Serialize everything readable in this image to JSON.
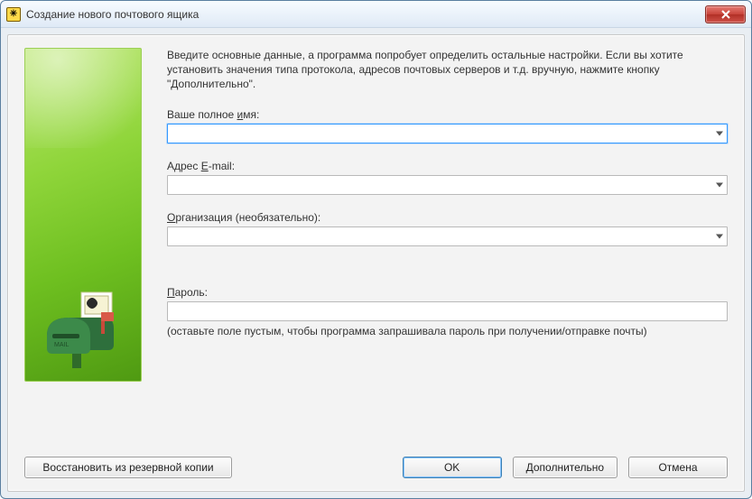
{
  "window": {
    "title": "Создание нового почтового ящика"
  },
  "intro": "Введите основные данные, а программа попробует определить остальные настройки. Если вы хотите установить значения типа протокола, адресов почтовых серверов и т.д. вручную, нажмите кнопку \"Дополнительно\".",
  "fields": {
    "name": {
      "label_pre": "Ваше полное ",
      "label_u": "и",
      "label_post": "мя:",
      "value": ""
    },
    "email": {
      "label_pre": "Адрес ",
      "label_u": "E",
      "label_post": "-mail:",
      "value": ""
    },
    "org": {
      "label_pre": "",
      "label_u": "О",
      "label_post": "рганизация (необязательно):",
      "value": ""
    },
    "password": {
      "label_pre": "",
      "label_u": "П",
      "label_post": "ароль:",
      "value": "",
      "hint": "(оставьте поле пустым, чтобы программа запрашивала пароль при получении/отправке почты)"
    }
  },
  "buttons": {
    "restore": "Восстановить из резервной копии",
    "ok": "OK",
    "more": "Дополнительно",
    "cancel": "Отмена"
  }
}
